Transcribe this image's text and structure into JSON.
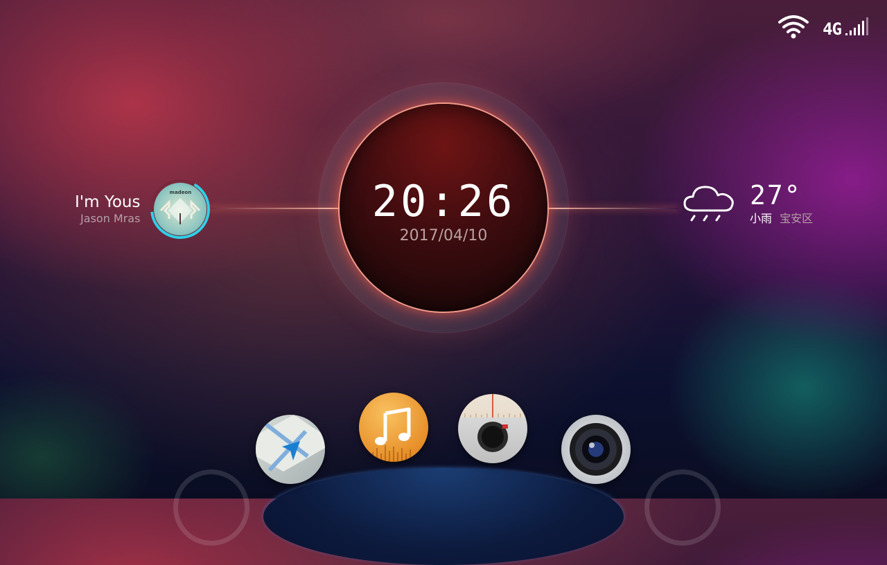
{
  "status_bar": {
    "wifi_icon": "wifi-icon",
    "network_label": "4G",
    "signal_icon": "signal-bars-icon"
  },
  "clock": {
    "time": "20:26",
    "date": "2017/04/10"
  },
  "now_playing": {
    "title": "I'm Yous",
    "artist": "Jason Mras",
    "album_art_text": "madeon",
    "progress_fraction": 0.65,
    "accent_color": "#2fd0e6"
  },
  "weather": {
    "icon": "cloud-rain-icon",
    "temperature": "27°",
    "condition": "小雨",
    "location": "宝安区"
  },
  "dock": {
    "apps": [
      {
        "name": "maps",
        "icon": "map-navigation-icon"
      },
      {
        "name": "music",
        "icon": "music-note-icon"
      },
      {
        "name": "radio",
        "icon": "radio-dial-icon"
      },
      {
        "name": "camera",
        "icon": "camera-lens-icon"
      }
    ]
  },
  "colors": {
    "glow": "#ff6a50",
    "music_orange": "#e7902a"
  }
}
